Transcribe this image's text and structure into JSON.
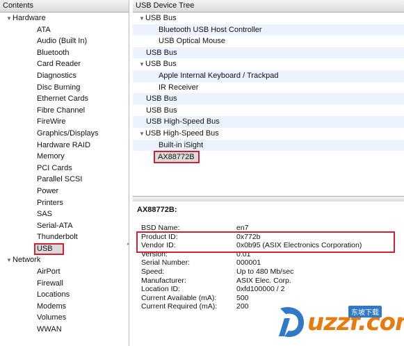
{
  "sidebar": {
    "header": "Contents",
    "hardware_label": "Hardware",
    "hardware_items": [
      "ATA",
      "Audio (Built In)",
      "Bluetooth",
      "Card Reader",
      "Diagnostics",
      "Disc Burning",
      "Ethernet Cards",
      "Fibre Channel",
      "FireWire",
      "Graphics/Displays",
      "Hardware RAID",
      "Memory",
      "PCI Cards",
      "Parallel SCSI",
      "Power",
      "Printers",
      "SAS",
      "Serial-ATA",
      "Thunderbolt"
    ],
    "selected_item": "USB",
    "network_label": "Network",
    "network_items": [
      "AirPort",
      "Firewall",
      "Locations",
      "Modems",
      "Volumes",
      "WWAN"
    ]
  },
  "device_tree": {
    "header": "USB Device Tree",
    "rows": [
      {
        "label": "USB Bus",
        "level": 0,
        "expanded": true
      },
      {
        "label": "Bluetooth USB Host Controller",
        "level": 1
      },
      {
        "label": "USB Optical Mouse",
        "level": 1
      },
      {
        "label": "USB Bus",
        "level": 0
      },
      {
        "label": "USB Bus",
        "level": 0,
        "expanded": true
      },
      {
        "label": "Apple Internal Keyboard / Trackpad",
        "level": 1
      },
      {
        "label": "IR Receiver",
        "level": 1
      },
      {
        "label": "USB Bus",
        "level": 0
      },
      {
        "label": "USB Bus",
        "level": 0
      },
      {
        "label": "USB High-Speed Bus",
        "level": 0
      },
      {
        "label": "USB High-Speed Bus",
        "level": 0,
        "expanded": true
      },
      {
        "label": "Built-in iSight",
        "level": 1
      },
      {
        "label": "AX88772B",
        "level": 1,
        "selected": true
      }
    ]
  },
  "detail": {
    "title": "AX88772B:",
    "properties": [
      {
        "key": "BSD Name:",
        "value": "en7"
      },
      {
        "key": "Product ID:",
        "value": "0x772b"
      },
      {
        "key": "Vendor ID:",
        "value": "0x0b95  (ASIX Electronics Corporation)"
      },
      {
        "key": "Version:",
        "value": "0.01"
      },
      {
        "key": "Serial Number:",
        "value": "000001"
      },
      {
        "key": "Speed:",
        "value": "Up to 480 Mb/sec"
      },
      {
        "key": "Manufacturer:",
        "value": "ASIX Elec. Corp."
      },
      {
        "key": "Location ID:",
        "value": "0xfd100000 / 2"
      },
      {
        "key": "Current Available (mA):",
        "value": "500"
      },
      {
        "key": "Current Required (mA):",
        "value": "200"
      }
    ]
  },
  "watermark": {
    "brand": "uzzf.com",
    "tag": "东坡下载"
  },
  "colors": {
    "highlight": "#cc2233",
    "zebra": "#edf3fe",
    "brand_orange": "#e87b10",
    "brand_blue": "#2f79c6"
  }
}
